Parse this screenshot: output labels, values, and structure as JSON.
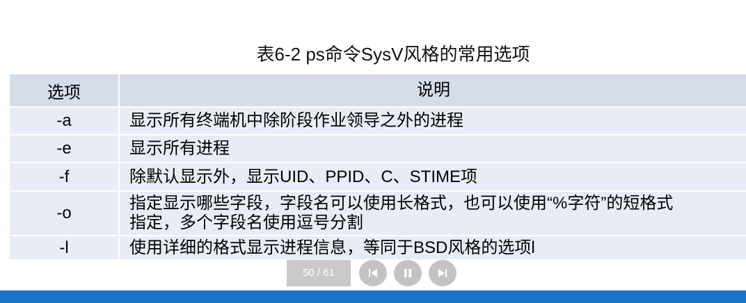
{
  "slide": {
    "title": "表6-2 ps命令SysV风格的常用选项",
    "table": {
      "headers": [
        "选项",
        "说明"
      ],
      "rows": [
        {
          "option": "-a",
          "description": "显示所有终端机中除阶段作业领导之外的进程"
        },
        {
          "option": "-e",
          "description": "显示所有进程"
        },
        {
          "option": "-f",
          "description": "除默认显示外，显示UID、PPID、C、STIME项"
        },
        {
          "option": "-o",
          "description_line1": "指定显示哪些字段，字段名可以使用长格式，也可以使用“%字符”的短格式",
          "description_line2": "指定，多个字段名使用逗号分割"
        },
        {
          "option": "-l",
          "description": "使用详细的格式显示进程信息，等同于BSD风格的选项l"
        }
      ]
    }
  },
  "player": {
    "page_counter": "50 / 61",
    "icons": {
      "previous": "skip-previous-icon",
      "pause": "pause-icon",
      "next": "skip-next-icon"
    }
  },
  "colors": {
    "header_row": "#d5dcea",
    "body_row": "#e8ecf4",
    "control_gray": "#c3c3c3",
    "bottom_bar": "#1a73c6"
  }
}
